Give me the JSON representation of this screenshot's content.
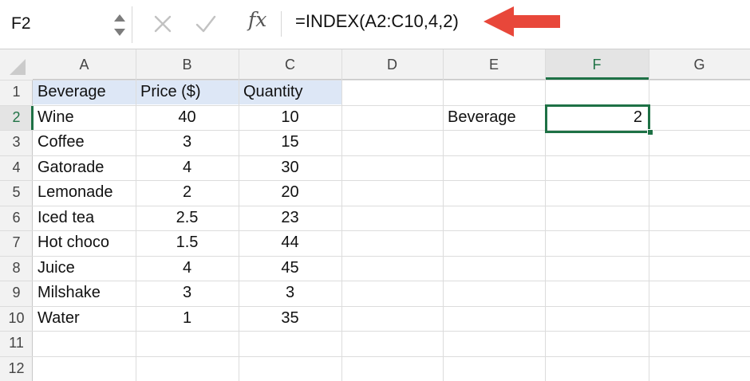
{
  "name_box": {
    "value": "F2"
  },
  "formula": {
    "fx_label": "fx",
    "text": "=INDEX(A2:C10,4,2)"
  },
  "columns": [
    "A",
    "B",
    "C",
    "D",
    "E",
    "F",
    "G"
  ],
  "rows": [
    "1",
    "2",
    "3",
    "4",
    "5",
    "6",
    "7",
    "8",
    "9",
    "10",
    "11",
    "12"
  ],
  "selected_column": "F",
  "selected_row": "2",
  "table": {
    "headers": [
      "Beverage",
      "Price ($)",
      "Quantity"
    ],
    "rows": [
      [
        "Wine",
        "40",
        "10"
      ],
      [
        "Coffee",
        "3",
        "15"
      ],
      [
        "Gatorade",
        "4",
        "30"
      ],
      [
        "Lemonade",
        "2",
        "20"
      ],
      [
        "Iced tea",
        "2.5",
        "23"
      ],
      [
        "Hot choco",
        "1.5",
        "44"
      ],
      [
        "Juice",
        "4",
        "45"
      ],
      [
        "Milshake",
        "3",
        "3"
      ],
      [
        "Water",
        "1",
        "35"
      ]
    ]
  },
  "lookup": {
    "label": "Beverage",
    "result": "2"
  },
  "colors": {
    "accent_green": "#1e7145",
    "header_fill": "#dde7f6",
    "arrow_red": "#e8473a"
  }
}
